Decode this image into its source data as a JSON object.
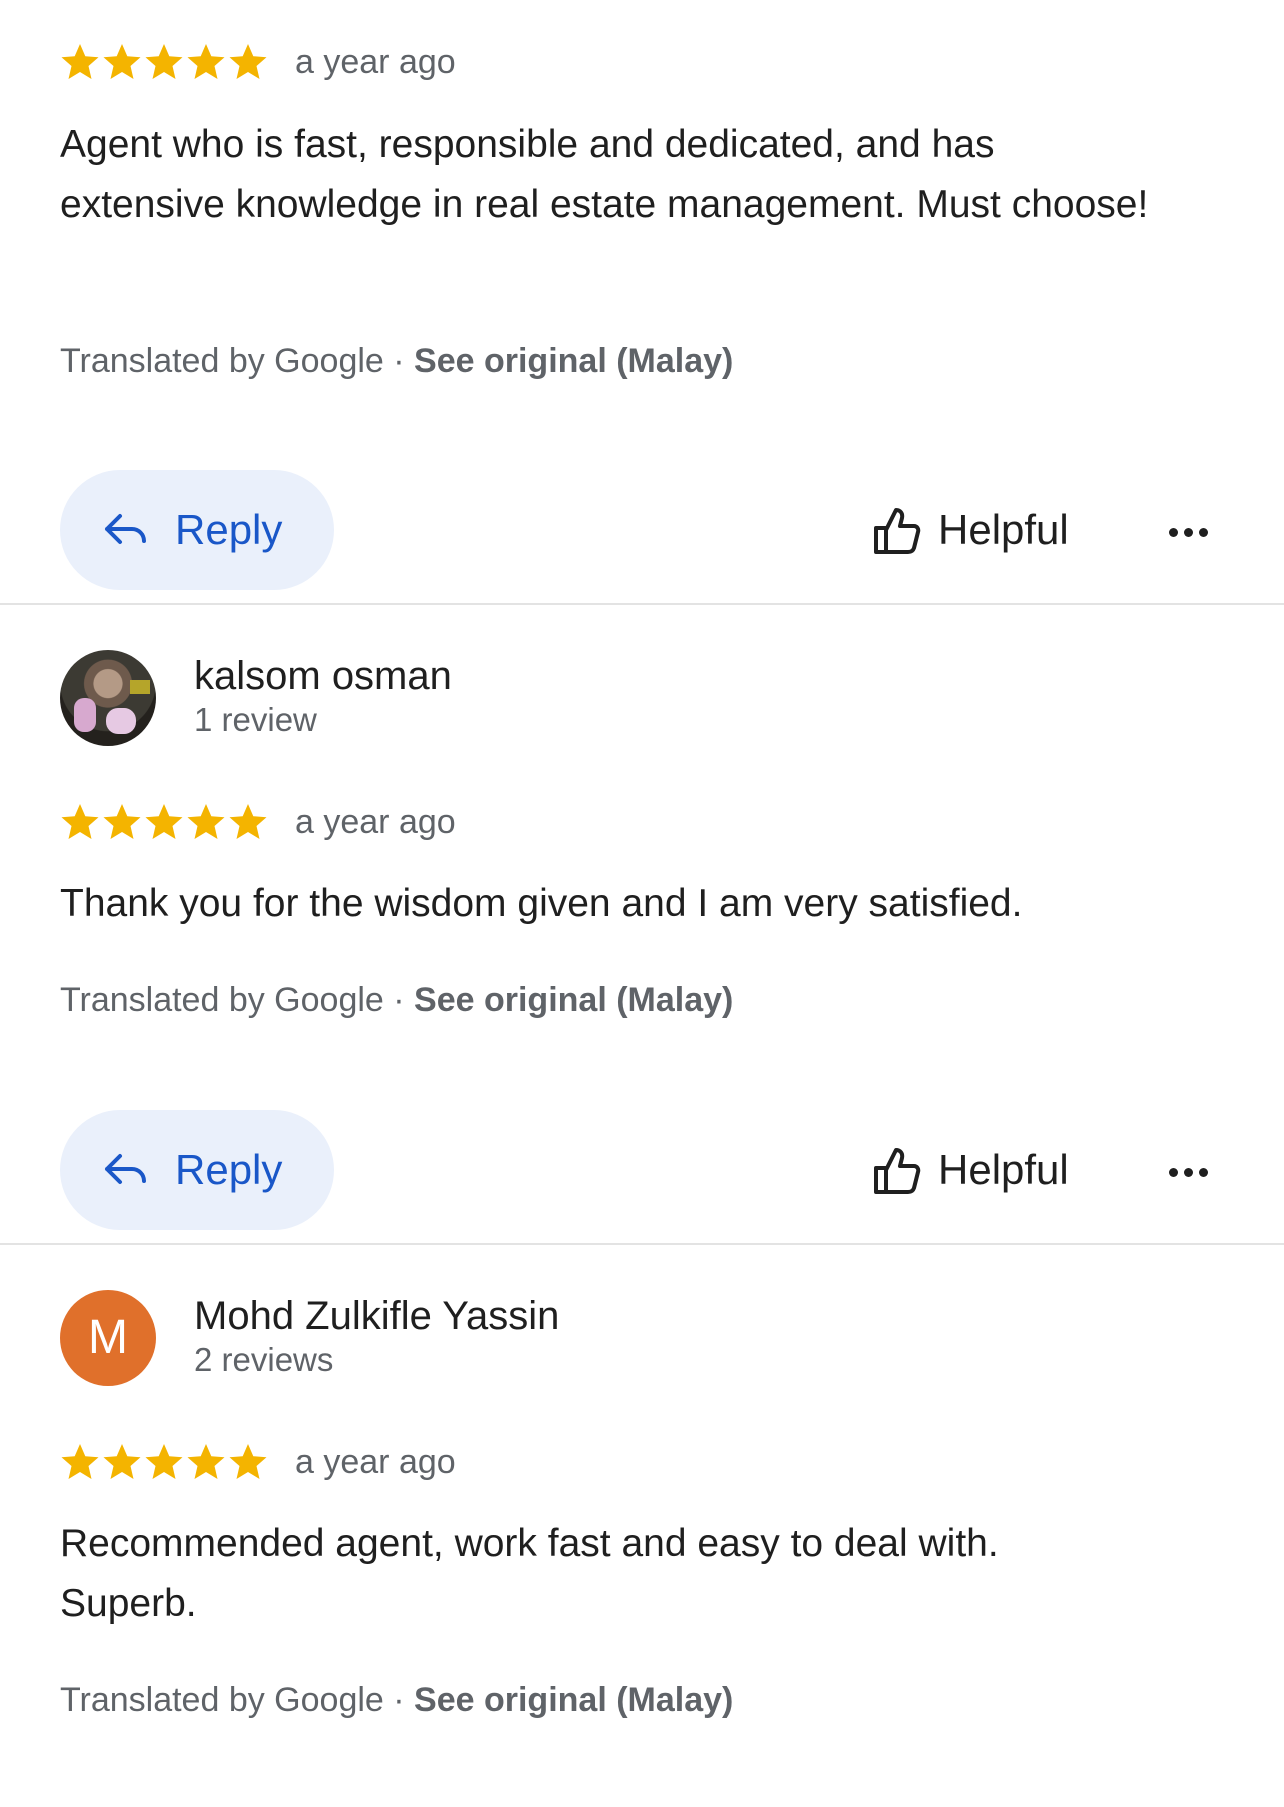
{
  "reviews": [
    {
      "rating": 5,
      "time": "a year ago",
      "text": "Agent who is fast, responsible and dedicated, and has extensive knowledge in real estate management. Must choose!",
      "translated_by": "Translated by Google · ",
      "see_original": "See original (Malay)",
      "reply_label": "Reply",
      "helpful_label": "Helpful"
    },
    {
      "author_name": "kalsom osman",
      "author_meta": "1 review",
      "rating": 5,
      "time": "a year ago",
      "text": "Thank you for the wisdom given and I am very satisfied.",
      "translated_by": "Translated by Google · ",
      "see_original": "See original (Malay)",
      "reply_label": "Reply",
      "helpful_label": "Helpful"
    },
    {
      "author_initial": "M",
      "author_name": "Mohd Zulkifle Yassin",
      "author_meta": "2 reviews",
      "rating": 5,
      "time": "a year ago",
      "text": "Recommended agent, work fast and easy to deal with. Superb.",
      "translated_by": "Translated by Google · ",
      "see_original": "See original (Malay)"
    }
  ],
  "colors": {
    "star": "#f4b400",
    "reply_bg": "#eaf0fb",
    "reply_text": "#1a57c8",
    "avatar_letter_bg": "#e0702b",
    "divider": "#e3e3e3"
  },
  "icons": {
    "star": "star-icon",
    "reply": "reply-arrow-icon",
    "helpful": "thumbs-up-icon",
    "more": "more-horizontal-icon"
  }
}
